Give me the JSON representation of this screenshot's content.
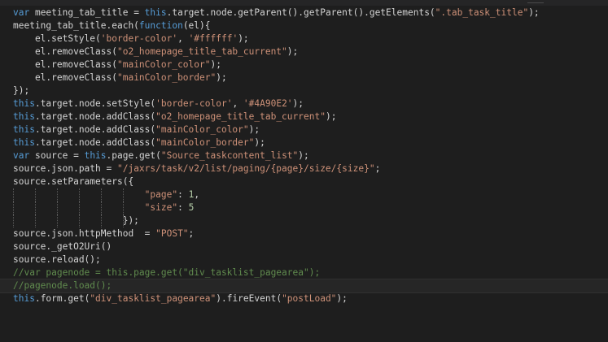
{
  "editor": {
    "lines": [
      [
        {
          "c": "kw",
          "t": "var"
        },
        {
          "c": "pl",
          "t": " meeting_tab_title = "
        },
        {
          "c": "kw",
          "t": "this"
        },
        {
          "c": "pl",
          "t": ".target.node.getParent().getParent().getElements("
        },
        {
          "c": "str",
          "t": "\".tab_task_title\""
        },
        {
          "c": "pl",
          "t": ");"
        }
      ],
      [
        {
          "c": "pl",
          "t": "meeting_tab_title.each("
        },
        {
          "c": "kw",
          "t": "function"
        },
        {
          "c": "pl",
          "t": "(el){"
        }
      ],
      [
        {
          "c": "pl",
          "t": "    el.setStyle("
        },
        {
          "c": "str",
          "t": "'border-color'"
        },
        {
          "c": "pl",
          "t": ", "
        },
        {
          "c": "str",
          "t": "'#ffffff'"
        },
        {
          "c": "pl",
          "t": ");"
        }
      ],
      [
        {
          "c": "pl",
          "t": "    el.removeClass("
        },
        {
          "c": "str",
          "t": "\"o2_homepage_title_tab_current\""
        },
        {
          "c": "pl",
          "t": ");"
        }
      ],
      [
        {
          "c": "pl",
          "t": "    el.removeClass("
        },
        {
          "c": "str",
          "t": "\"mainColor_color\""
        },
        {
          "c": "pl",
          "t": ");"
        }
      ],
      [
        {
          "c": "pl",
          "t": "    el.removeClass("
        },
        {
          "c": "str",
          "t": "\"mainColor_border\""
        },
        {
          "c": "pl",
          "t": ");"
        }
      ],
      [
        {
          "c": "pl",
          "t": "});"
        }
      ],
      [
        {
          "c": "kw",
          "t": "this"
        },
        {
          "c": "pl",
          "t": ".target.node.setStyle("
        },
        {
          "c": "str",
          "t": "'border-color'"
        },
        {
          "c": "pl",
          "t": ", "
        },
        {
          "c": "str",
          "t": "'#4A90E2'"
        },
        {
          "c": "pl",
          "t": ");"
        }
      ],
      [
        {
          "c": "kw",
          "t": "this"
        },
        {
          "c": "pl",
          "t": ".target.node.addClass("
        },
        {
          "c": "str",
          "t": "\"o2_homepage_title_tab_current\""
        },
        {
          "c": "pl",
          "t": ");"
        }
      ],
      [
        {
          "c": "kw",
          "t": "this"
        },
        {
          "c": "pl",
          "t": ".target.node.addClass("
        },
        {
          "c": "str",
          "t": "\"mainColor_color\""
        },
        {
          "c": "pl",
          "t": ");"
        }
      ],
      [
        {
          "c": "kw",
          "t": "this"
        },
        {
          "c": "pl",
          "t": ".target.node.addClass("
        },
        {
          "c": "str",
          "t": "\"mainColor_border\""
        },
        {
          "c": "pl",
          "t": ");"
        }
      ],
      [
        {
          "c": "kw",
          "t": "var"
        },
        {
          "c": "pl",
          "t": " source = "
        },
        {
          "c": "kw",
          "t": "this"
        },
        {
          "c": "pl",
          "t": ".page.get("
        },
        {
          "c": "str",
          "t": "\"Source_taskcontent_list\""
        },
        {
          "c": "pl",
          "t": ");"
        }
      ],
      [
        {
          "c": "pl",
          "t": "source.json.path = "
        },
        {
          "c": "str",
          "t": "\"/jaxrs/task/v2/list/paging/{page}/size/{size}\""
        },
        {
          "c": "pl",
          "t": ";"
        }
      ],
      [
        {
          "c": "pl",
          "t": "source.setParameters({"
        }
      ],
      [
        {
          "c": "pl",
          "t": "                        "
        },
        {
          "c": "str",
          "t": "\"page\""
        },
        {
          "c": "pl",
          "t": ": "
        },
        {
          "c": "num",
          "t": "1"
        },
        {
          "c": "pl",
          "t": ","
        }
      ],
      [
        {
          "c": "pl",
          "t": "                        "
        },
        {
          "c": "str",
          "t": "\"size\""
        },
        {
          "c": "pl",
          "t": ": "
        },
        {
          "c": "num",
          "t": "5"
        }
      ],
      [
        {
          "c": "pl",
          "t": "                    });"
        }
      ],
      [
        {
          "c": "pl",
          "t": "source.json.httpMethod  = "
        },
        {
          "c": "str",
          "t": "\"POST\""
        },
        {
          "c": "pl",
          "t": ";"
        }
      ],
      [
        {
          "c": "pl",
          "t": "source._getO2Uri()"
        }
      ],
      [
        {
          "c": "pl",
          "t": "source.reload();"
        }
      ],
      [
        {
          "c": "cm",
          "t": "//var pagenode = this.page.get(\"div_tasklist_pagearea\");"
        }
      ],
      [
        {
          "c": "cm",
          "t": "//pagenode.load();"
        }
      ],
      [
        {
          "c": "kw",
          "t": "this"
        },
        {
          "c": "pl",
          "t": ".form.get("
        },
        {
          "c": "str",
          "t": "\"div_tasklist_pagearea\""
        },
        {
          "c": "pl",
          "t": ").fireEvent("
        },
        {
          "c": "str",
          "t": "\"postLoad\""
        },
        {
          "c": "pl",
          "t": ");"
        }
      ]
    ],
    "current_line_index": 21,
    "guide_lines": [
      14,
      15,
      16
    ],
    "colors": {
      "background": "#1e1e1e",
      "keyword": "#569cd6",
      "string": "#ce9178",
      "number": "#b5cea8",
      "comment": "#608b4e",
      "plain": "#d4d4d4"
    }
  }
}
